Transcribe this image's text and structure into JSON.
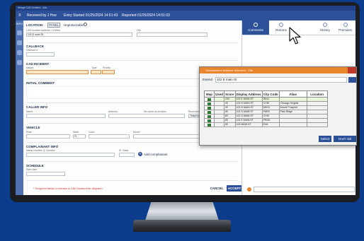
{
  "window": {
    "title": "Mirage CAD Incident - Ads"
  },
  "topbar": {
    "received_by": "Received by J Hoe",
    "entry_started": "Entry Started 01/25/2024 14:51:43",
    "reported": "Reported 01/25/2024 14:51:03"
  },
  "nav": {
    "info_label": "INFO"
  },
  "form": {
    "location_label": "LOCATION",
    "location_badge": "PANEL",
    "unprotected_label": "Unprotectable",
    "address_sublabel": "CAD location Address / # Miles",
    "city_sublabel": "City",
    "address_value": "102 E main St",
    "callback_label": "CALLBACK",
    "callback_sublabel": "Callback #",
    "cad_incident_label": "CAD INCIDENT",
    "nature_sublabel": "Nature",
    "type_sublabel": "Type",
    "priority_sublabel": "Priority",
    "initial_comment_label": "INITIAL COMMENT",
    "caller_info_label": "CALLER INFO",
    "name_sublabel": "Name",
    "address_sublabel2": "Address",
    "same_as_location": "No same as location",
    "received_via_sublabel": "Received via",
    "received_via_value": "Telephone",
    "vehicle_label": "VEHICLE",
    "plate_sublabel": "Plate",
    "state_sublabel": "State",
    "color_sublabel": "Color",
    "model_sublabel": "Model",
    "state_value": "FL",
    "complainant_label": "COMPLAINANT INFO",
    "complainant_sublabel": "Name Number Q, Number",
    "st_state_sublabel": "St. State",
    "add_complainant": "Add complainant",
    "schedule_label": "SCHEDULE",
    "start_sublabel": "Start date",
    "required_note": "* Required fields to release a CAD incident for dispatch",
    "cancel_label": "CANCEL",
    "accept_label": "ACCEPT"
  },
  "right_tabs": [
    {
      "label": "Comments",
      "active": true
    },
    {
      "label": "Returns",
      "active": false
    },
    {
      "label": "History",
      "active": false
    },
    {
      "label": "Premises",
      "active": false
    }
  ],
  "dialog": {
    "title": "Geobaselane Address Selection - File",
    "extend_label": "Extend",
    "search_value": "102 E main St",
    "columns": [
      "Map",
      "Used",
      "Score",
      "Display Address",
      "City Code",
      "Alias",
      "Location"
    ],
    "rows": [
      [
        "",
        "",
        "100",
        "102 E MAIN ST",
        "INVU",
        "",
        ""
      ],
      [
        "",
        "",
        "90",
        "102 N MAIN ST",
        "CHHI",
        "Chicago Heights",
        ""
      ],
      [
        "",
        "",
        "90",
        "102 N MAIN ST",
        "MOGI",
        "Mount Prospect",
        ""
      ],
      [
        "",
        "",
        "80",
        "102 S MAIN ST",
        "PARK",
        "Park Ridge",
        ""
      ],
      [
        "",
        "",
        "80",
        "102 S MAIN ST",
        "CHHI",
        "",
        ""
      ],
      [
        "",
        "",
        "80",
        "102 E MAIN ST",
        "PRGE",
        "",
        ""
      ],
      [
        "",
        "",
        "80",
        "102 MAIN ST",
        "EVA",
        "",
        ""
      ]
    ],
    "select_label": "Select",
    "dont_validate_label": "Don't Val"
  },
  "colors": {
    "topbar": "#2d5199",
    "accent_orange": "#e8842b",
    "page_background": "#0c3c8c",
    "required_red": "#d32f2f"
  }
}
